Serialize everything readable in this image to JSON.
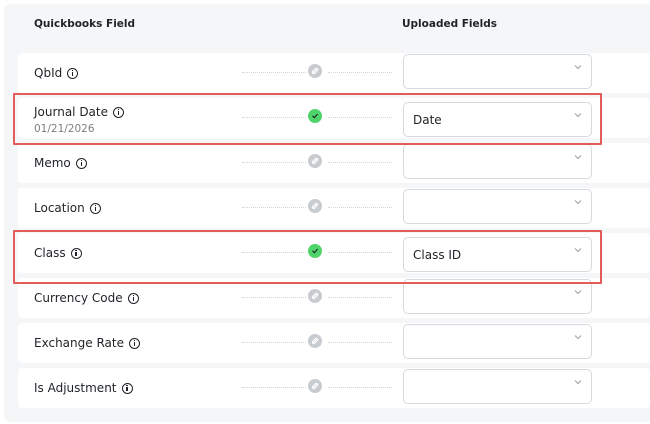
{
  "headers": {
    "quickbooks_field": "Quickbooks Field",
    "uploaded_fields": "Uploaded Fields"
  },
  "rows": [
    {
      "label": "QbId",
      "sub": "",
      "mapped": false,
      "value": ""
    },
    {
      "label": "Journal Date",
      "sub": "01/21/2026",
      "mapped": true,
      "value": "Date"
    },
    {
      "label": "Memo",
      "sub": "",
      "mapped": false,
      "value": ""
    },
    {
      "label": "Location",
      "sub": "",
      "mapped": false,
      "value": ""
    },
    {
      "label": "Class",
      "sub": "",
      "mapped": true,
      "value": "Class ID"
    },
    {
      "label": "Currency Code",
      "sub": "",
      "mapped": false,
      "value": ""
    },
    {
      "label": "Exchange Rate",
      "sub": "",
      "mapped": false,
      "value": ""
    },
    {
      "label": "Is Adjustment",
      "sub": "",
      "mapped": false,
      "value": ""
    }
  ],
  "colors": {
    "mapped_dot": "#4fd36b",
    "unmapped_dot": "#c8ccd1",
    "highlight": "#e25c5c"
  }
}
